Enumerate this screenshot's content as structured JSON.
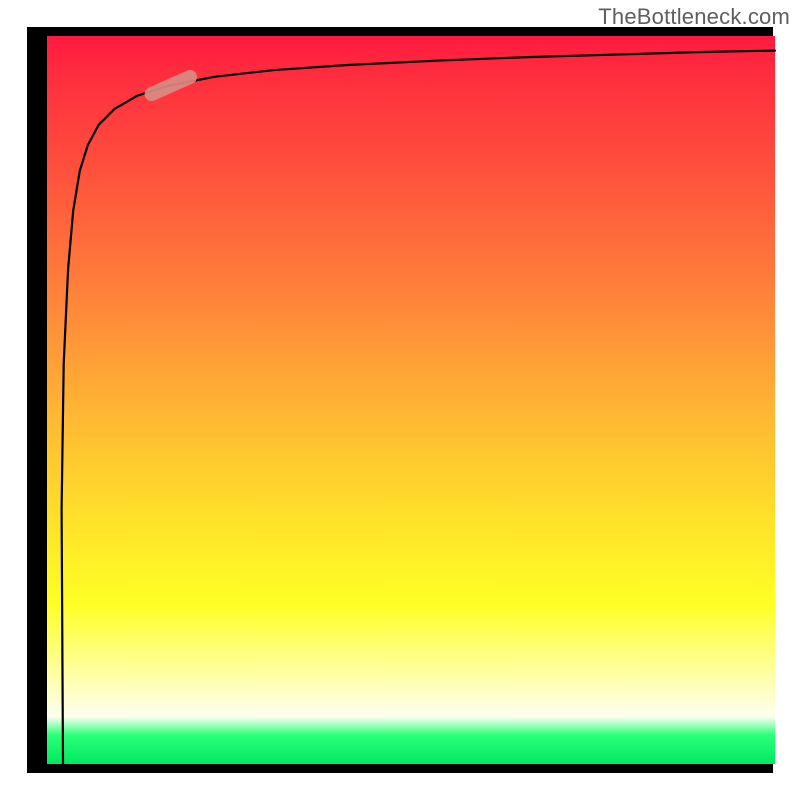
{
  "attribution": "TheBottleneck.com",
  "chart_data": {
    "type": "line",
    "title": "",
    "xlabel": "",
    "ylabel": "",
    "xlim": [
      0,
      100
    ],
    "ylim": [
      0,
      100
    ],
    "series": [
      {
        "name": "curve",
        "x": [
          2.2,
          2.0,
          2.3,
          2.9,
          3.6,
          4.5,
          5.6,
          7.1,
          9.3,
          12.4,
          16.8,
          23.0,
          31.0,
          41.0,
          53.0,
          66.0,
          80.0,
          90.0,
          100.0
        ],
        "y": [
          0.0,
          35.0,
          55.0,
          68.0,
          76.0,
          81.5,
          85.0,
          87.8,
          90.0,
          91.8,
          93.2,
          94.4,
          95.3,
          96.0,
          96.6,
          97.1,
          97.5,
          97.8,
          98.0
        ]
      }
    ],
    "marker": {
      "x": 17,
      "y": 93.2,
      "angle_deg": -24
    },
    "gradient_stops": [
      {
        "pct": 0,
        "color": "#ff1a3f"
      },
      {
        "pct": 6,
        "color": "#ff2f3e"
      },
      {
        "pct": 22,
        "color": "#ff5a3c"
      },
      {
        "pct": 38,
        "color": "#ff8a3a"
      },
      {
        "pct": 52,
        "color": "#ffb733"
      },
      {
        "pct": 66,
        "color": "#ffe02a"
      },
      {
        "pct": 78,
        "color": "#ffff25"
      },
      {
        "pct": 88,
        "color": "#ffffa8"
      },
      {
        "pct": 93.5,
        "color": "#fdfff0"
      },
      {
        "pct": 96,
        "color": "#2dff7a"
      },
      {
        "pct": 100,
        "color": "#00e961"
      }
    ]
  }
}
